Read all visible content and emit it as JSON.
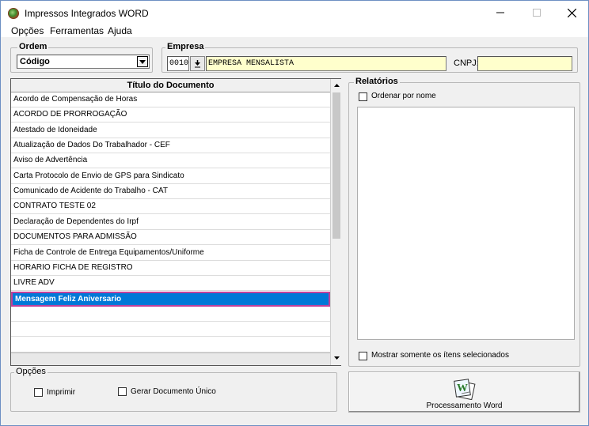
{
  "window": {
    "title": "Impressos Integrados WORD"
  },
  "menu": [
    "Opções",
    "Ferramentas",
    "Ajuda"
  ],
  "ordem": {
    "legend": "Ordem",
    "value": "Código"
  },
  "empresa": {
    "legend": "Empresa",
    "code": "0010",
    "name": "EMPRESA MENSALISTA",
    "cnpj_label": "CNPJ:",
    "cnpj_value": ""
  },
  "grid": {
    "header": "Título do Documento",
    "rows": [
      "Acordo de Compensação de Horas",
      "ACORDO DE PRORROGAÇÃO",
      "Atestado de Idoneidade",
      "Atualização de Dados Do Trabalhador - CEF",
      "Aviso de Advertência",
      "Carta Protocolo de Envio de GPS para Sindicato",
      "Comunicado de Acidente do Trabalho - CAT",
      "CONTRATO TESTE 02",
      "Declaração de Dependentes do Irpf",
      "DOCUMENTOS PARA ADMISSÃO",
      "Ficha de Controle de Entrega Equipamentos/Uniforme",
      "HORARIO FICHA DE REGISTRO",
      "LIVRE ADV",
      "Mensagem Feliz Aniversario"
    ],
    "selected_index": 13
  },
  "relatorios": {
    "legend": "Relatórios",
    "order_by_name": "Ordenar por nome",
    "only_selected": "Mostrar somente os ítens selecionados"
  },
  "opcoes": {
    "legend": "Opções",
    "print": "Imprimir",
    "single_doc": "Gerar Documento Único"
  },
  "process_button": {
    "label": "Processamento Word",
    "icon": "word-document-icon"
  },
  "colors": {
    "selection": "#0078d7",
    "highlight_field": "#ffffcc",
    "selection_border": "#c0409a"
  }
}
